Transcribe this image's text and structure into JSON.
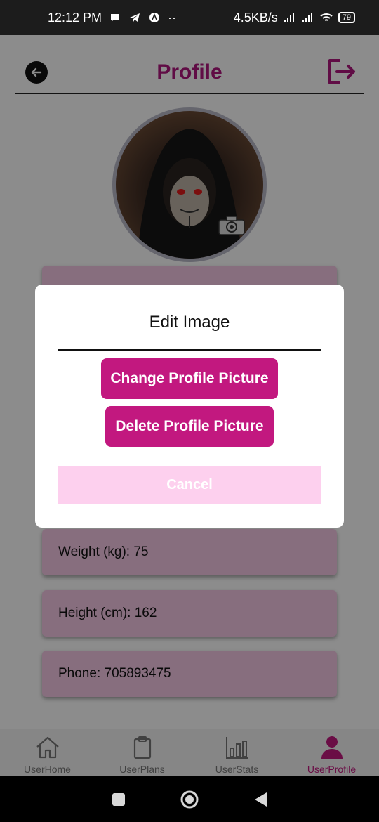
{
  "status_bar": {
    "time": "12:12 PM",
    "speed": "4.5KB/s",
    "battery": "79"
  },
  "header": {
    "title": "Profile",
    "back_icon": "arrow-left-circle-icon",
    "logout_icon": "logout-icon"
  },
  "profile": {
    "camera_icon": "camera-icon"
  },
  "info_cards": [
    {
      "label": "Weight (kg): 75"
    },
    {
      "label": "Height (cm): 162"
    },
    {
      "label": "Phone: 705893475"
    }
  ],
  "modal": {
    "title": "Edit Image",
    "change_label": "Change Profile Picture",
    "delete_label": "Delete Profile Picture",
    "cancel_label": "Cancel"
  },
  "bottom_nav": {
    "items": [
      {
        "label": "UserHome",
        "icon": "home-icon"
      },
      {
        "label": "UserPlans",
        "icon": "clipboard-icon"
      },
      {
        "label": "UserStats",
        "icon": "bar-chart-icon"
      },
      {
        "label": "UserProfile",
        "icon": "person-icon",
        "active": true
      }
    ]
  },
  "colors": {
    "accent": "#c2187f",
    "cancel_bg": "#fdd0ee",
    "card_bg": "#f6c8e6"
  }
}
